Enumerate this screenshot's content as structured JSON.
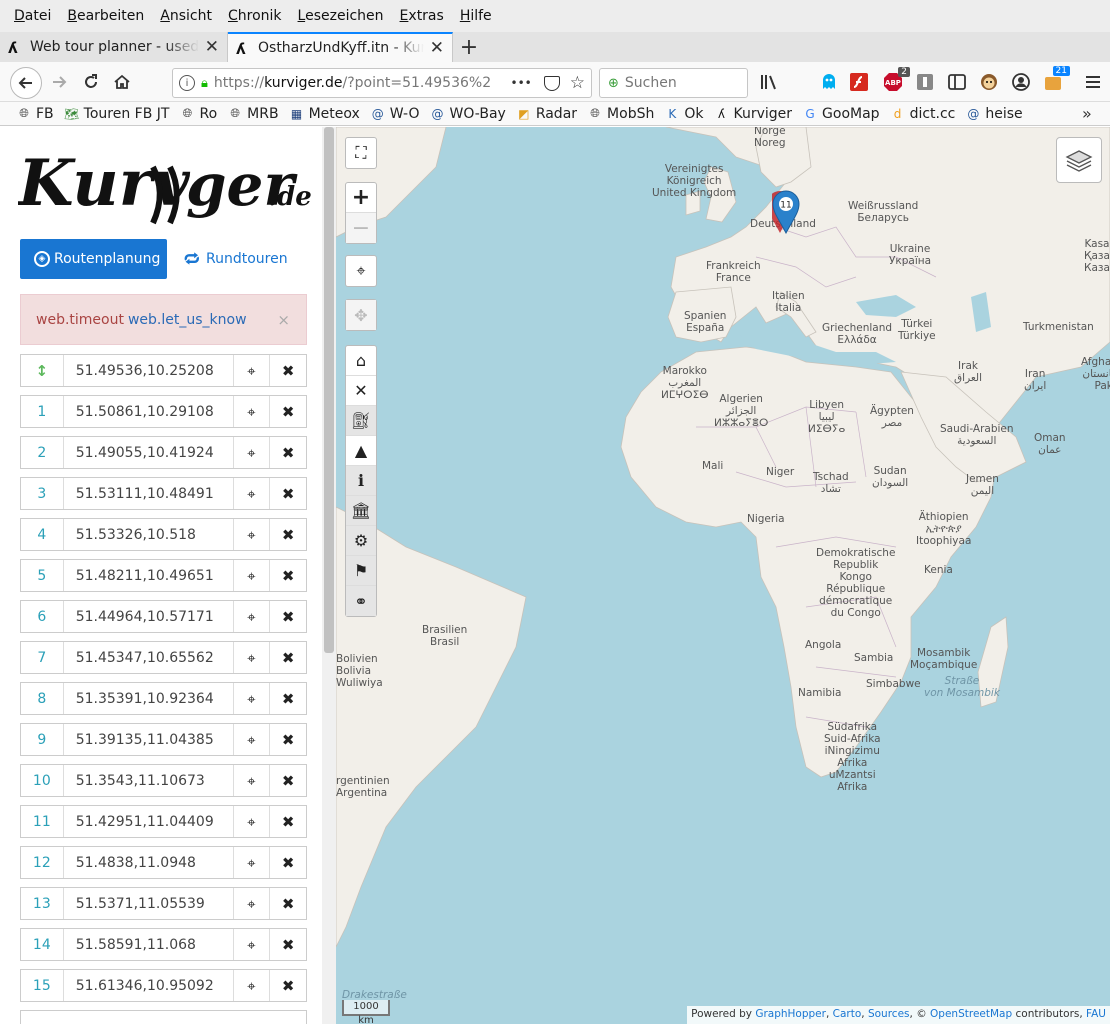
{
  "menu": [
    "Datei",
    "Bearbeiten",
    "Ansicht",
    "Chronik",
    "Lesezeichen",
    "Extras",
    "Hilfe"
  ],
  "tabs": [
    {
      "title": "Web tour planner - used b",
      "close": "✕"
    },
    {
      "title": "OstharzUndKyff.itn - Kurv",
      "close": "✕"
    }
  ],
  "new_tab": "+",
  "navbar": {
    "url_prefix": "https://",
    "url_host": "kurviger.de",
    "url_rest": "/?point=51.49536%2",
    "more": "•••",
    "search_placeholder": "Suchen",
    "abp_badge": "2",
    "ext_badge": "21"
  },
  "bookmarks": [
    {
      "label": "FB",
      "icon": "globe"
    },
    {
      "label": "Touren FB JT",
      "icon": "route"
    },
    {
      "label": "Ro",
      "icon": "globe"
    },
    {
      "label": "MRB",
      "icon": "globe"
    },
    {
      "label": "Meteox",
      "icon": "meteox"
    },
    {
      "label": "W-O",
      "icon": "at"
    },
    {
      "label": "WO-Bay",
      "icon": "at"
    },
    {
      "label": "Radar",
      "icon": "radar"
    },
    {
      "label": "MobSh",
      "icon": "globe"
    },
    {
      "label": "Ok",
      "icon": "k"
    },
    {
      "label": "Kurviger",
      "icon": "kurviger"
    },
    {
      "label": "GooMap",
      "icon": "google"
    },
    {
      "label": "dict.cc",
      "icon": "dict"
    },
    {
      "label": "heise",
      "icon": "at"
    }
  ],
  "sidebar": {
    "logo_main": "Kurv",
    "logo_tail": "ger",
    "logo_tld": ".de",
    "route_button": "Routenplanung",
    "round_button": "Rundtouren",
    "alert_text": "web.timeout",
    "alert_link": "web.let_us_know",
    "alert_close": "×"
  },
  "waypoints": [
    {
      "num": "↕",
      "coord": "51.49536,10.25208"
    },
    {
      "num": "1",
      "coord": "51.50861,10.29108"
    },
    {
      "num": "2",
      "coord": "51.49055,10.41924"
    },
    {
      "num": "3",
      "coord": "51.53111,10.48491"
    },
    {
      "num": "4",
      "coord": "51.53326,10.518"
    },
    {
      "num": "5",
      "coord": "51.48211,10.49651"
    },
    {
      "num": "6",
      "coord": "51.44964,10.57171"
    },
    {
      "num": "7",
      "coord": "51.45347,10.65562"
    },
    {
      "num": "8",
      "coord": "51.35391,10.92364"
    },
    {
      "num": "9",
      "coord": "51.39135,11.04385"
    },
    {
      "num": "10",
      "coord": "51.3543,11.10673"
    },
    {
      "num": "11",
      "coord": "51.42951,11.04409"
    },
    {
      "num": "12",
      "coord": "51.4838,11.0948"
    },
    {
      "num": "13",
      "coord": "51.5371,11.05539"
    },
    {
      "num": "14",
      "coord": "51.58591,11.068"
    },
    {
      "num": "15",
      "coord": "51.61346,10.95092"
    }
  ],
  "map": {
    "marker_label": "11",
    "scale": "1000 km",
    "attribution": {
      "prefix": "Powered by",
      "graphhopper": "GraphHopper",
      "carto": "Carto",
      "sources": "Sources",
      "mid": ", ©",
      "osm": "OpenStreetMap",
      "contributors": "contributors,",
      "fau": "FAU"
    },
    "labels": [
      {
        "text": "Norge\nNoreg",
        "water": false
      },
      {
        "text": "Vereinigtes\nKönigreich\nUnited Kingdom",
        "water": false
      },
      {
        "text": "Deutschland",
        "water": false
      },
      {
        "text": "Weißrussland\nБеларусь",
        "water": false
      },
      {
        "text": "Ukraine\nУкраїна",
        "water": false
      },
      {
        "text": "Kasa\nҚаза\nКаза",
        "water": false
      },
      {
        "text": "Frankreich\nFrance",
        "water": false
      },
      {
        "text": "Italien\nItalia",
        "water": false
      },
      {
        "text": "Spanien\nEspaña",
        "water": false
      },
      {
        "text": "Griechenland\nΕλλάδα",
        "water": false
      },
      {
        "text": "Türkei\nTürkiye",
        "water": false
      },
      {
        "text": "Turkmenistan",
        "water": false
      },
      {
        "text": "Marokko\nالمغرب\nⵍⵎⵖⵔⵉⴱ",
        "water": false
      },
      {
        "text": "Algerien\nالجزائر\nⵍⵣⵣⴰⵢⴻⵔ",
        "water": false
      },
      {
        "text": "Libyen\nليبيا\nⵍⵉⴱⵢⴰ",
        "water": false
      },
      {
        "text": "Ägypten\nمصر",
        "water": false
      },
      {
        "text": "Irak\nالعراق",
        "water": false
      },
      {
        "text": "Iran\nایران",
        "water": false
      },
      {
        "text": "Afghanis\nافغانستان\nPak",
        "water": false
      },
      {
        "text": "Saudi-Arabien\nالسعودية",
        "water": false
      },
      {
        "text": "Oman\nعمان",
        "water": false
      },
      {
        "text": "Mali",
        "water": false
      },
      {
        "text": "Niger",
        "water": false
      },
      {
        "text": "Tschad\nتشاد",
        "water": false
      },
      {
        "text": "Sudan\nالسودان",
        "water": false
      },
      {
        "text": "Jemen\nاليمن",
        "water": false
      },
      {
        "text": "Nigeria",
        "water": false
      },
      {
        "text": "Äthiopien\nኢትዮጵያ\nItoophiyaa",
        "water": false
      },
      {
        "text": "Demokratische\nRepublik\nKongo\nRépublique\ndémocratique\ndu Congo",
        "water": false
      },
      {
        "text": "Kenia",
        "water": false
      },
      {
        "text": "Brasilien\nBrasil",
        "water": false
      },
      {
        "text": "Bolivien\nBolivia\nWuliwiya",
        "water": false
      },
      {
        "text": "Angola",
        "water": false
      },
      {
        "text": "Sambia",
        "water": false
      },
      {
        "text": "Mosambik\nMoçambique",
        "water": false
      },
      {
        "text": "Straße\nvon Mosambik",
        "water": true
      },
      {
        "text": "Namibia",
        "water": false
      },
      {
        "text": "Simbabwe",
        "water": false
      },
      {
        "text": "Südafrika\nSuid-Afrika\niNingizimu\nAfrika\nuMzantsi\nAfrika",
        "water": false
      },
      {
        "text": "rgentinien\nArgentina",
        "water": false
      },
      {
        "text": "Drakestraße",
        "water": true
      }
    ]
  }
}
